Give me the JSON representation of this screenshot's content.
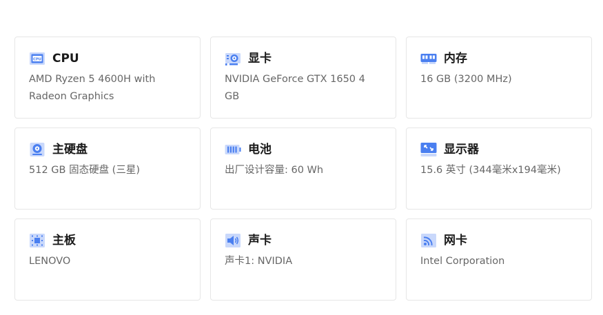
{
  "cards": [
    {
      "title": "CPU",
      "value": "AMD Ryzen 5 4600H with Radeon Graphics",
      "icon": "cpu-icon"
    },
    {
      "title": "显卡",
      "value": "NVIDIA GeForce GTX 1650 4 GB",
      "icon": "gpu-icon"
    },
    {
      "title": "内存",
      "value": "16 GB (3200 MHz)",
      "icon": "memory-icon"
    },
    {
      "title": "主硬盘",
      "value": "512 GB 固态硬盘 (三星)",
      "icon": "hard-disk-icon"
    },
    {
      "title": "电池",
      "value": "出厂设计容量: 60 Wh",
      "icon": "battery-icon"
    },
    {
      "title": "显示器",
      "value": "15.6 英寸 (344毫米x194毫米)",
      "icon": "monitor-icon"
    },
    {
      "title": "主板",
      "value": "LENOVO",
      "icon": "motherboard-icon"
    },
    {
      "title": "声卡",
      "value": "声卡1: NVIDIA",
      "icon": "speaker-icon"
    },
    {
      "title": "网卡",
      "value": "Intel Corporation",
      "icon": "network-icon"
    }
  ],
  "colors": {
    "icon_primary": "#4a7ff0",
    "icon_light": "#c9d8fb",
    "title": "#1a1a1a",
    "value": "#666666",
    "border": "#e6e6e6"
  }
}
